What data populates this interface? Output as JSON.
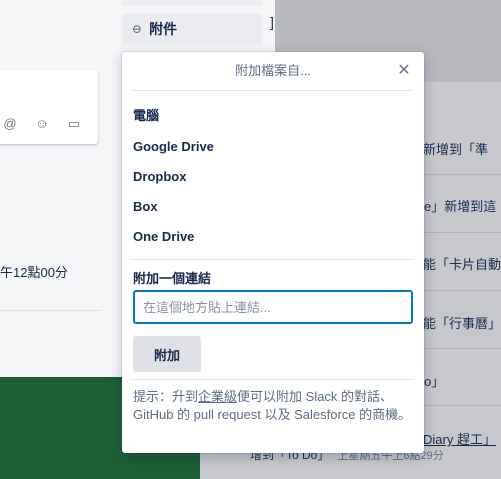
{
  "background": {
    "activity_time": "午12點00分",
    "comment_icons": [
      "at-icon",
      "smiley-icon",
      "card-icon"
    ],
    "right_top_glyph": "]",
    "right_lines": [
      "新增到「準",
      "e」新增到這",
      "能「卡片自動",
      "能「行事曆」",
      "o」",
      "Diary 趕工」"
    ],
    "right_bottom": {
      "label": "增到「To Do」",
      "time": "上星期五午上6點29分"
    }
  },
  "sidebar": {
    "attachment_label": "附件"
  },
  "popover": {
    "title": "附加檔案自...",
    "close_icon": "close-icon",
    "sources_heading": "電腦",
    "sources": [
      "Google Drive",
      "Dropbox",
      "Box",
      "One Drive"
    ],
    "link_heading": "附加一個連結",
    "link_input": {
      "value": "",
      "placeholder": "在這個地方貼上連結..."
    },
    "attach_button": "附加",
    "tip": {
      "prefix": "提示：升到",
      "link": "企業級",
      "suffix": "便可以附加 Slack 的對話、GitHub 的 pull request 以及 Salesforce 的商機。"
    }
  },
  "colors": {
    "accent": "#0079bf",
    "board_green": "#1e5e35"
  }
}
